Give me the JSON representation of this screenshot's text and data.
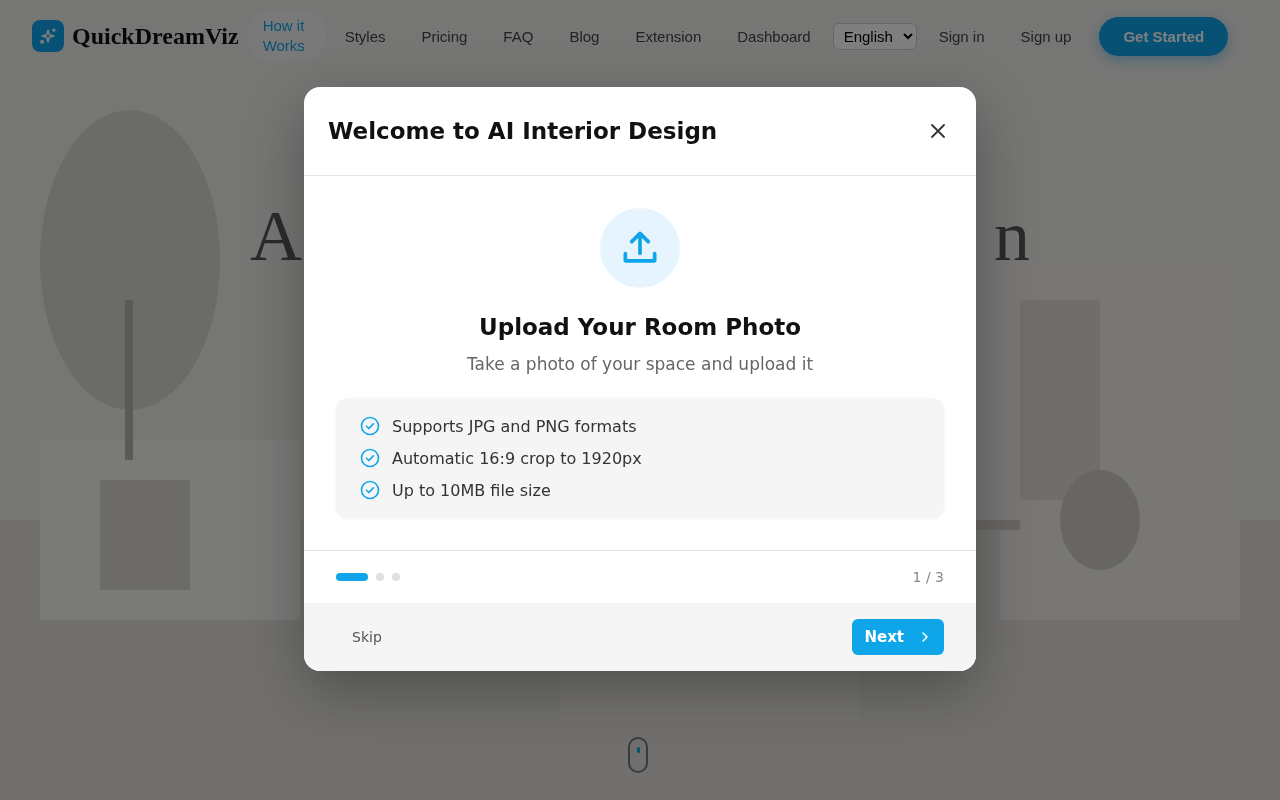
{
  "brand": {
    "name": "QuickDreamViz"
  },
  "nav": [
    {
      "label": "How it Works",
      "selected": true
    },
    {
      "label": "Styles",
      "selected": false
    },
    {
      "label": "Pricing",
      "selected": false
    },
    {
      "label": "FAQ",
      "selected": false
    },
    {
      "label": "Blog",
      "selected": false
    },
    {
      "label": "Extension",
      "selected": false
    },
    {
      "label": "Dashboard",
      "selected": false
    }
  ],
  "language": {
    "value": "English"
  },
  "auth": {
    "sign_in": "Sign in",
    "sign_up": "Sign up",
    "cta": "Get Started"
  },
  "hero": {
    "heading_left": "A",
    "heading_right": "n"
  },
  "dialog": {
    "title": "Welcome to AI Interior Design",
    "step_title": "Upload Your Room Photo",
    "step_subtitle": "Take a photo of your space and upload it",
    "features": [
      "Supports JPG and PNG formats",
      "Automatic 16:9 crop to 1920px",
      "Up to 10MB file size"
    ],
    "steps": [
      {
        "selected": true
      },
      {
        "selected": false
      },
      {
        "selected": false
      }
    ],
    "counter": "1 / 3",
    "skip": "Skip",
    "next": "Next"
  }
}
